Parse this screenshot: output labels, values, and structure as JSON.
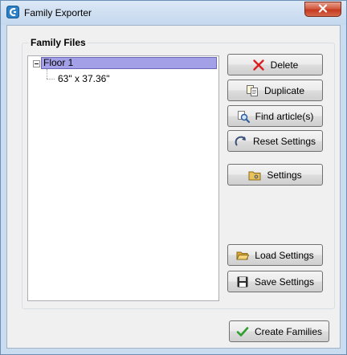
{
  "window": {
    "title": "Family Exporter",
    "close_glyph": "✕"
  },
  "group": {
    "label": "Family Files"
  },
  "tree": {
    "root": {
      "label": "Floor 1",
      "expanded": true,
      "selected": true
    },
    "child": {
      "label": "63\" x 37.36\""
    }
  },
  "buttons": {
    "delete": {
      "label": "Delete",
      "icon": "red-x-icon"
    },
    "duplicate": {
      "label": "Duplicate",
      "icon": "duplicate-icon"
    },
    "find": {
      "label": "Find article(s)",
      "icon": "magnifier-icon"
    },
    "reset": {
      "label": "Reset Settings",
      "icon": "reset-arrow-icon"
    },
    "settings": {
      "label": "Settings",
      "icon": "settings-folder-icon"
    },
    "load": {
      "label": "Load Settings",
      "icon": "open-folder-icon"
    },
    "save": {
      "label": "Save Settings",
      "icon": "floppy-disk-icon"
    },
    "create": {
      "label": "Create Families",
      "icon": "green-check-icon"
    }
  },
  "colors": {
    "selection": "#a4a0e8",
    "close": "#c4391f",
    "delete_icon": "#d92020",
    "check_icon": "#2f9d2f"
  }
}
